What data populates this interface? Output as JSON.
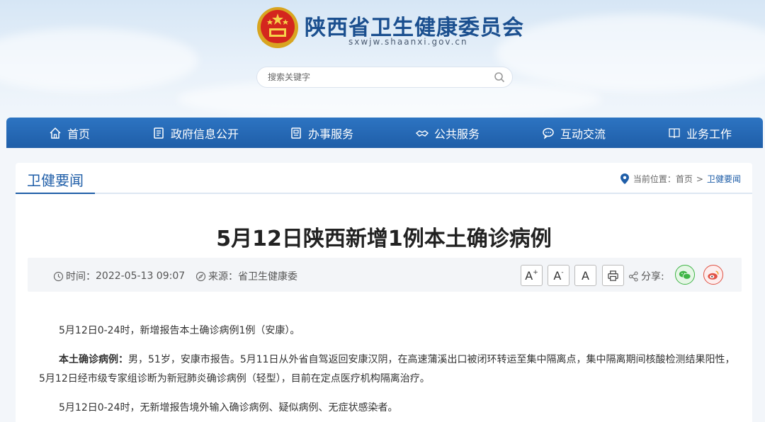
{
  "header": {
    "site_title": "陕西省卫生健康委员会",
    "site_url": "sxwjw.shaanxi.gov.cn",
    "search_placeholder": "搜索关键字",
    "emblem_icon": "national-emblem-icon"
  },
  "nav": {
    "items": [
      {
        "label": "首页",
        "icon": "home-icon"
      },
      {
        "label": "政府信息公开",
        "icon": "document-icon"
      },
      {
        "label": "办事服务",
        "icon": "service-icon"
      },
      {
        "label": "公共服务",
        "icon": "handshake-icon"
      },
      {
        "label": "互动交流",
        "icon": "chat-icon"
      },
      {
        "label": "业务工作",
        "icon": "book-icon"
      }
    ]
  },
  "section": {
    "title": "卫健要闻",
    "location_label": "当前位置：",
    "crumbs": [
      "首页",
      "卫健要闻"
    ],
    "separator": ">"
  },
  "article": {
    "title": "5月12日陕西新增1例本土确诊病例",
    "time_label": "时间：",
    "time_value": "2022-05-13 09:07",
    "source_label": "来源：",
    "source_value": "省卫生健康委",
    "font_buttons": [
      "A",
      "A",
      "A"
    ],
    "share_label": "分享:",
    "paragraphs": {
      "p1": "5月12日0-24时，新增报告本土确诊病例1例（安康）。",
      "p2_bold": "本土确诊病例：",
      "p2_rest": "男，51岁，安康市报告。5月11日从外省自驾返回安康汉阴，在高速蒲溪出口被闭环转运至集中隔离点，集中隔离期间核酸检测结果阳性，5月12日经市级专家组诊断为新冠肺炎确诊病例（轻型），目前在定点医疗机构隔离治疗。",
      "p3": "5月12日0-24时，无新增报告境外输入确诊病例、疑似病例、无症状感染者。"
    }
  },
  "colors": {
    "brand_blue": "#1f5ea8",
    "nav_blue": "#2d74c2",
    "wechat_green": "#3fb546",
    "weibo_red": "#e05244"
  }
}
